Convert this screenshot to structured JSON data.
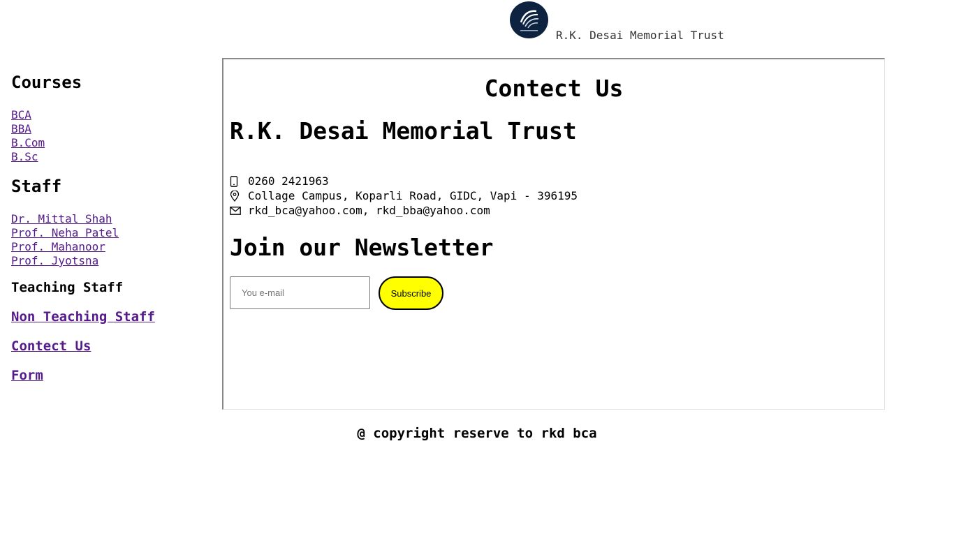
{
  "header": {
    "logo_icon": "trust-logo",
    "site_title": "R.K. Desai Memorial Trust"
  },
  "sidebar": {
    "courses_heading": "Courses",
    "courses": [
      "BCA",
      "BBA",
      "B.Com",
      "B.Sc"
    ],
    "staff_heading": "Staff",
    "staff": [
      "Dr. Mittal Shah",
      "Prof. Neha Patel",
      "Prof. Mahanoor",
      "Prof. Jyotsna"
    ],
    "teaching_staff": "Teaching Staff",
    "non_teaching_staff": "Non Teaching Staff",
    "contact_us": "Contect Us",
    "form": "Form"
  },
  "main": {
    "title": "Contect Us",
    "org_name": "R.K. Desai Memorial Trust",
    "contact": {
      "phone_icon": "phone-icon",
      "phone": "0260 2421963",
      "location_icon": "location-pin-icon",
      "address": "Collage Campus, Koparli Road, GIDC, Vapi - 396195",
      "mail_icon": "envelope-icon",
      "email": "rkd_bca@yahoo.com, rkd_bba@yahoo.com"
    },
    "newsletter": {
      "title": "Join our Newsletter",
      "email_placeholder": "You e-mail",
      "email_value": "",
      "subscribe_label": "Subscribe",
      "subscribe_color": "#ffff00"
    }
  },
  "footer": {
    "copyright": "@ copyright reserve to rkd bca"
  },
  "colors": {
    "link": "#551a8b",
    "logo_bg": "#0d2340"
  }
}
